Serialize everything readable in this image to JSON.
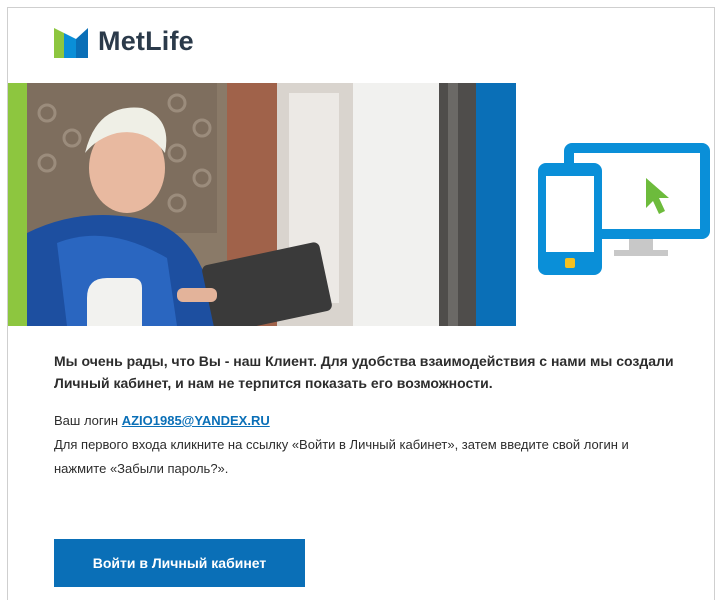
{
  "brand": {
    "name": "MetLife"
  },
  "hero": {
    "icon": "devices-icon"
  },
  "body": {
    "intro": "Мы очень рады, что Вы - наш Клиент. Для удобства взаимодействия с нами мы создали Личный кабинет, и нам не терпится показать его возможности.",
    "login_prefix": "Ваш логин ",
    "login_value": "AZIO1985@YANDEX.RU",
    "instructions": "Для первого входа кликните на ссылку «Войти в Личный кабинет», затем введите свой логин и нажмите «Забыли пароль?»."
  },
  "cta": {
    "label": "Войти в Личный кабинет"
  },
  "colors": {
    "brand_blue": "#0a6fb7",
    "brand_green": "#8dc63f",
    "logo_text": "#2b3a4a"
  }
}
